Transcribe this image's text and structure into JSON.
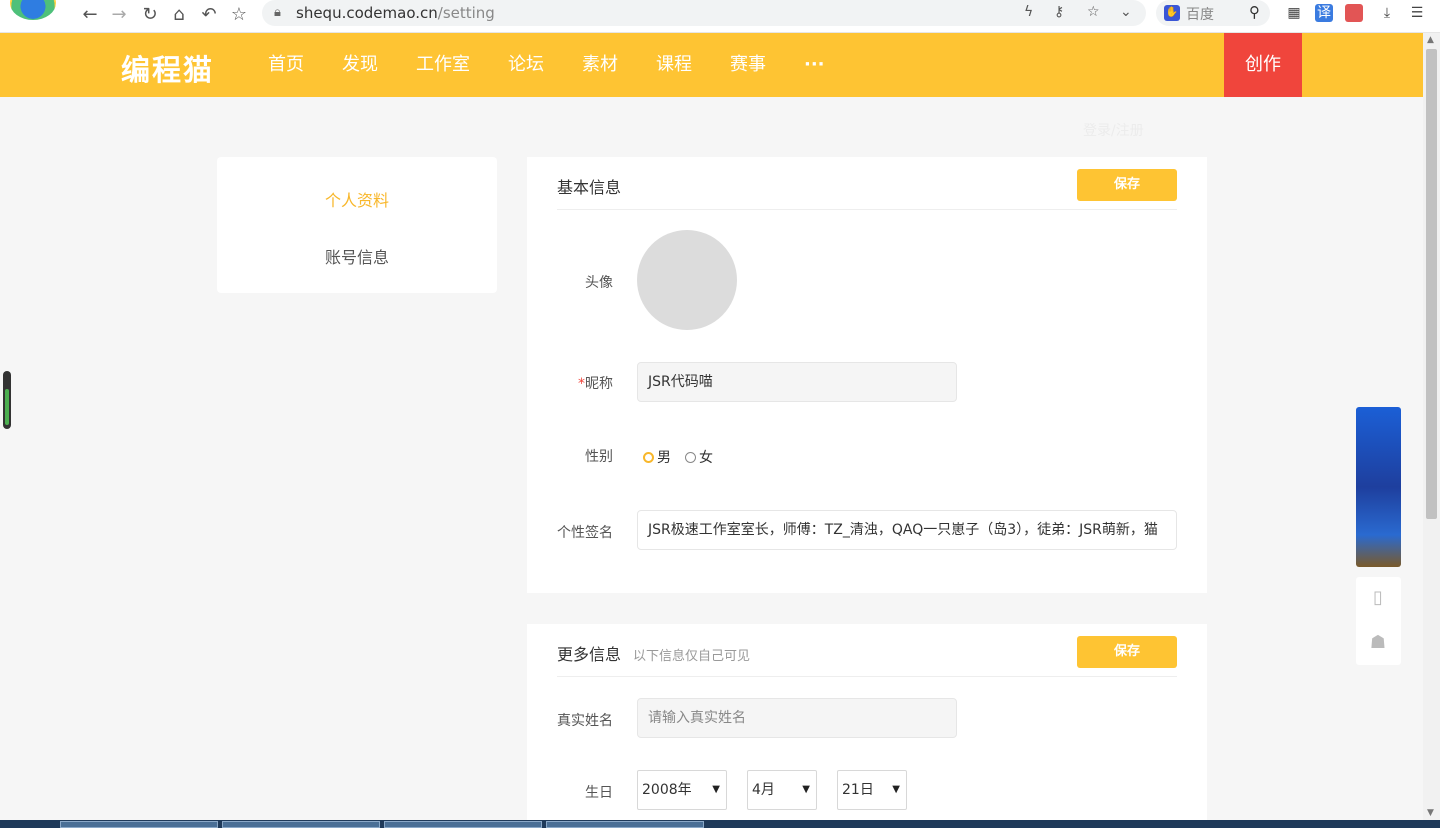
{
  "browser": {
    "url_host": "shequ.codemao.cn",
    "url_path": "/setting",
    "search_engine_label": "百度"
  },
  "header": {
    "logo": "编程猫",
    "nav": [
      "首页",
      "发现",
      "工作室",
      "论坛",
      "素材",
      "课程",
      "赛事",
      "···"
    ],
    "create_label": "创作",
    "login_label": "登录/注册"
  },
  "sidebar": {
    "items": [
      {
        "label": "个人资料",
        "active": true
      },
      {
        "label": "账号信息",
        "active": false
      }
    ]
  },
  "basic_info": {
    "title": "基本信息",
    "save_label": "保存",
    "avatar_label": "头像",
    "nickname_label": "昵称",
    "nickname_required_mark": "*",
    "nickname_value": "JSR代码喵",
    "gender_label": "性别",
    "gender_options": [
      "男",
      "女"
    ],
    "gender_selected": "男",
    "signature_label": "个性签名",
    "signature_value": "JSR极速工作室室长，师傅：TZ_清浊，QAQ一只崽子（岛3），徒弟：JSR萌新，猫"
  },
  "more_info": {
    "title": "更多信息",
    "subtitle": "以下信息仅自己可见",
    "save_label": "保存",
    "realname_label": "真实姓名",
    "realname_placeholder": "请输入真实姓名",
    "birthday_label": "生日",
    "birth_year": "2008年",
    "birth_month": "4月",
    "birth_day": "21日"
  },
  "colors": {
    "brand_yellow": "#fec433",
    "create_red": "#f0453c",
    "active_text": "#f8b72b"
  }
}
